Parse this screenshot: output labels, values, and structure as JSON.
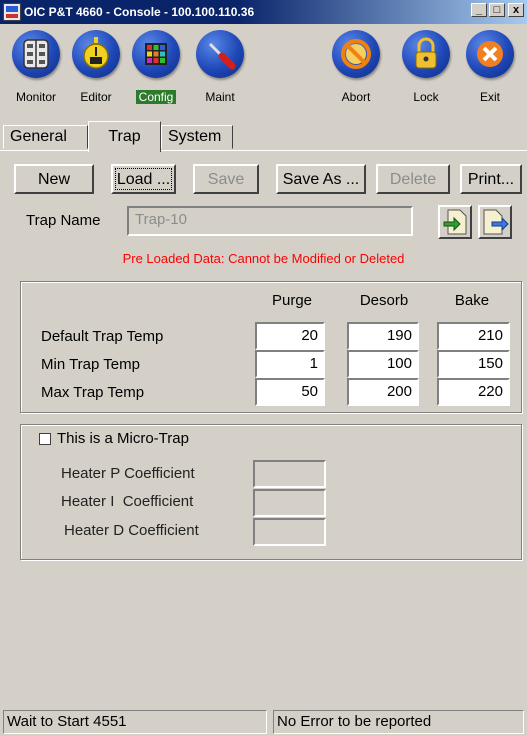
{
  "window": {
    "title": "OIC P&T 4660 - Console - 100.100.110.36",
    "minimize_glyph": "_",
    "restore_glyph": "□",
    "close_glyph": "x"
  },
  "toolbar": {
    "buttons": [
      {
        "label": "Monitor",
        "icon": "monitor-icon"
      },
      {
        "label": "Editor",
        "icon": "stopwatch-icon"
      },
      {
        "label": "Config",
        "icon": "grid-icon",
        "active": true
      },
      {
        "label": "Maint",
        "icon": "screwdriver-icon"
      },
      {
        "label": "Abort",
        "icon": "abort-icon"
      },
      {
        "label": "Lock",
        "icon": "lock-icon"
      },
      {
        "label": "Exit",
        "icon": "exit-icon"
      }
    ],
    "colors": {
      "circle": "#1f48b8",
      "abort_ring": "#f08010",
      "lock": "#f0c030",
      "exit": "#f08020",
      "active_label_bg": "#2c7a2c"
    }
  },
  "tabs": [
    {
      "label": "General"
    },
    {
      "label": "Trap",
      "active": true
    },
    {
      "label": "System"
    }
  ],
  "actions": {
    "new": "New",
    "load": "Load ...",
    "save": "Save",
    "save_as": "Save As ...",
    "delete": "Delete",
    "print": "Print..."
  },
  "trap": {
    "name_label": "Trap Name",
    "name_value": "Trap-10",
    "warning": "Pre Loaded Data: Cannot be Modified or Deleted",
    "warning_color": "#ff0000"
  },
  "temps": {
    "columns": [
      "Purge",
      "Desorb",
      "Bake"
    ],
    "rows": [
      {
        "label": "Default Trap Temp",
        "values": [
          "20",
          "190",
          "210"
        ]
      },
      {
        "label": "Min Trap Temp",
        "values": [
          "1",
          "100",
          "150"
        ]
      },
      {
        "label": "Max Trap Temp",
        "values": [
          "50",
          "200",
          "220"
        ]
      }
    ]
  },
  "micro_trap": {
    "checkbox_label": "This is a Micro-Trap",
    "checked": false,
    "coefficients": [
      {
        "label": "Heater P Coefficient",
        "value": ""
      },
      {
        "label": "Heater I  Coefficient",
        "value": ""
      },
      {
        "label": "Heater D Coefficient",
        "value": ""
      }
    ]
  },
  "status": {
    "left": "Wait to Start 4551",
    "right": "No Error to be reported"
  }
}
